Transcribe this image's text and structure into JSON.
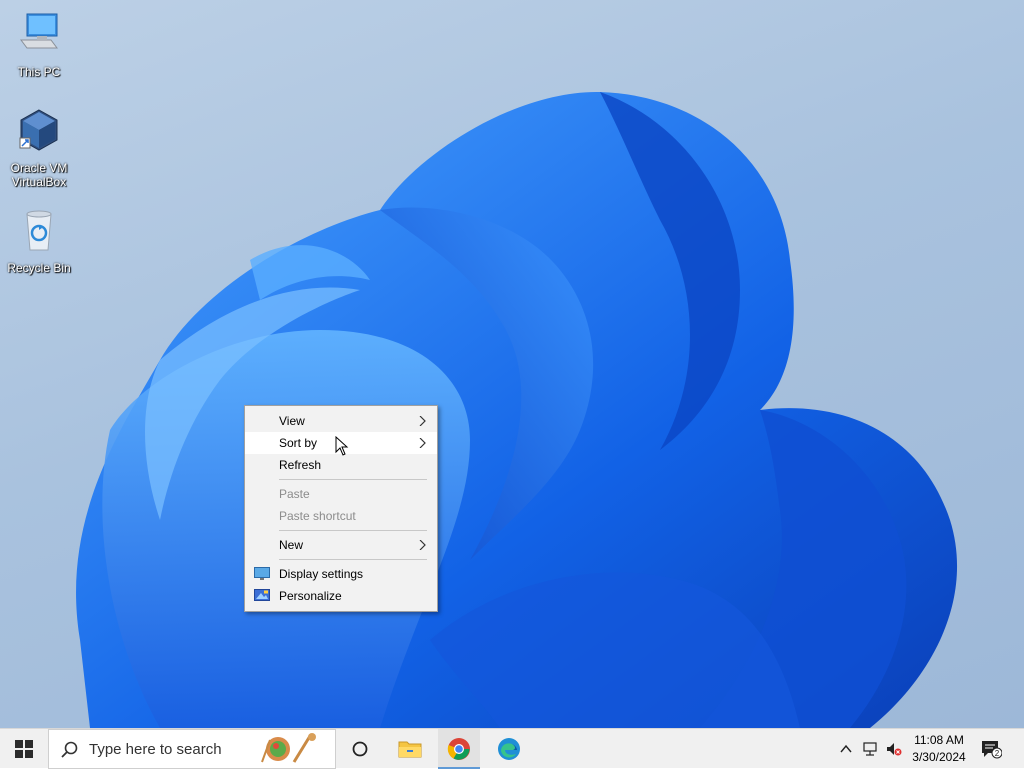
{
  "desktop": {
    "icons": [
      {
        "label": "This PC",
        "icon": "computer-icon"
      },
      {
        "label": "Oracle VM VirtualBox",
        "icon": "virtualbox-icon"
      },
      {
        "label": "Recycle Bin",
        "icon": "recycle-bin-icon"
      }
    ]
  },
  "context_menu": {
    "items": [
      {
        "label": "View",
        "submenu": true,
        "enabled": true
      },
      {
        "label": "Sort by",
        "submenu": true,
        "enabled": true,
        "hovered": true
      },
      {
        "label": "Refresh",
        "submenu": false,
        "enabled": true
      },
      {
        "label": "Paste",
        "submenu": false,
        "enabled": false
      },
      {
        "label": "Paste shortcut",
        "submenu": false,
        "enabled": false
      },
      {
        "label": "New",
        "submenu": true,
        "enabled": true
      },
      {
        "label": "Display settings",
        "submenu": false,
        "enabled": true,
        "icon": "display-icon"
      },
      {
        "label": "Personalize",
        "submenu": false,
        "enabled": true,
        "icon": "personalize-icon"
      }
    ]
  },
  "taskbar": {
    "search_placeholder": "Type here to search",
    "pinned": [
      "task-view-icon",
      "file-explorer-icon",
      "chrome-icon",
      "edge-icon"
    ],
    "active_app": "chrome-icon",
    "clock": {
      "time": "11:08 AM",
      "date": "3/30/2024"
    },
    "notification_count": "2"
  },
  "colors": {
    "accent": "#1a73e8",
    "taskbar_bg": "#f0f0f0",
    "menu_bg": "#f2f2f2",
    "disabled_text": "#8c8c8c"
  }
}
